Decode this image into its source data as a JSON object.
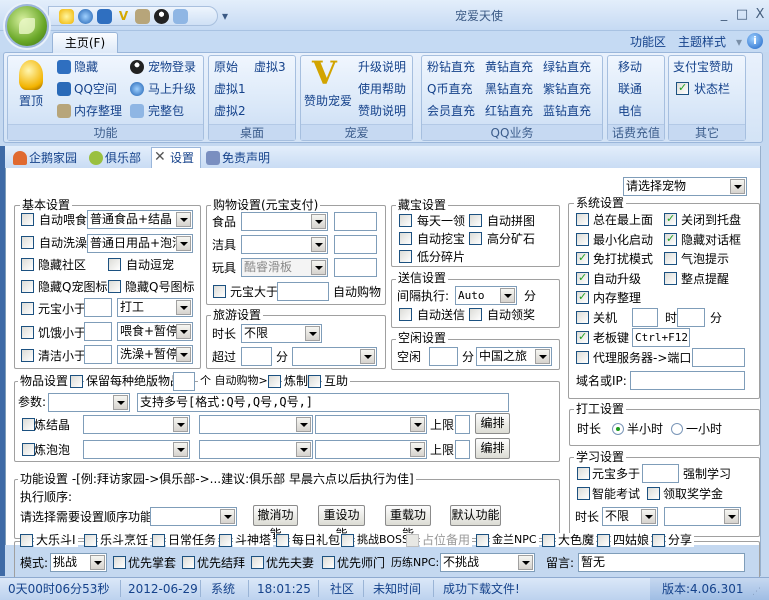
{
  "window": {
    "title": "宠爱天使",
    "minimize": "_",
    "maximize": "□",
    "close": "X"
  },
  "quick_access": {
    "icons": [
      "bulb-icon",
      "globe-upgrade-icon",
      "hide-icon",
      "v-icon",
      "memory-icon",
      "penguin-icon",
      "package-icon"
    ],
    "customize": "▾"
  },
  "ribbon": {
    "tab": "主页(F)",
    "right": {
      "function_area": "功能区",
      "theme": "主题样式",
      "theme_arrow": "▾"
    },
    "groups": {
      "function": {
        "label": "功能",
        "pin_top": "置顶",
        "hide": "隐藏",
        "qzone": "QQ空间",
        "memory": "内存整理",
        "pet_login": "宠物登录",
        "upgrade": "马上升级",
        "full_package": "完整包"
      },
      "desktop": {
        "label": "桌面",
        "original": "原始",
        "virtual3": "虚拟3",
        "virtual1": "虚拟1",
        "virtual2": "虚拟2"
      },
      "pet": {
        "label": "宠爱",
        "sponsor_pet": "赞助宠爱",
        "upgrade_notes": "升级说明",
        "help": "使用帮助",
        "sponsor_notes": "赞助说明"
      },
      "qq": {
        "label": "QQ业务",
        "items": [
          "粉钻直充",
          "黄钻直充",
          "绿钻直充",
          "Q币直充",
          "黑钻直充",
          "紫钻直充",
          "会员直充",
          "红钻直充",
          "蓝钻直充"
        ]
      },
      "phone": {
        "label": "话费充值",
        "items": [
          "移动",
          "联通",
          "电信"
        ]
      },
      "other": {
        "label": "其它",
        "alipay": "支付宝赞助",
        "statusbar": "状态栏",
        "statusbar_checked": true
      }
    }
  },
  "subtabs": [
    "企鹅家园",
    "俱乐部",
    "设置",
    "免责声明"
  ],
  "active_subtab": "设置",
  "pet_select": "请选择宠物",
  "basic": {
    "title": "基本设置",
    "auto_feed": "自动喂食",
    "feed_value": "普通食品+结晶",
    "auto_bath": "自动洗澡",
    "bath_value": "普通日用品+泡泡",
    "hide_community": "隐藏社区",
    "auto_tease": "自动逗宠",
    "hide_pet_icon": "隐藏Q宠图标",
    "hide_qq_icon": "隐藏Q号图标",
    "yb_less": "元宝小于",
    "yb_action": "打工",
    "hunger_less": "饥饿小于",
    "hunger_action": "喂食+暂停",
    "clean_less": "清洁小于",
    "clean_action": "洗澡+暂停"
  },
  "shopping": {
    "title": "购物设置(元宝支付)",
    "food": "食品",
    "cleaner": "洁具",
    "toy": "玩具",
    "toy_value": "酷睿滑板",
    "yb_more": "元宝大于",
    "auto_buy": "自动购物"
  },
  "travel": {
    "title": "旅游设置",
    "duration": "时长",
    "duration_value": "不限",
    "over": "超过",
    "minutes": "分"
  },
  "treasure": {
    "title": "藏宝设置",
    "daily": "每天一领",
    "puzzle": "自动拼图",
    "dig": "自动挖宝",
    "high_ore": "高分矿石",
    "low_frag": "低分碎片"
  },
  "mail": {
    "title": "送信设置",
    "interval": "间隔执行:",
    "interval_value": "Auto",
    "minutes": "分",
    "auto_send": "自动送信",
    "auto_claim": "自动领奖"
  },
  "idle": {
    "title": "空闲设置",
    "idle": "空闲",
    "minutes": "分",
    "idle_value": "中国之旅"
  },
  "system": {
    "title": "系统设置",
    "always_top": "总在最上面",
    "close_tray": "关闭到托盘",
    "min_start": "最小化启动",
    "hide_dialog": "隐藏对话框",
    "dnd": "免打扰模式",
    "bubble": "气泡提示",
    "auto_upgrade": "自动升级",
    "hourly": "整点提醒",
    "memory": "内存整理",
    "shutdown": "关机",
    "hour": "时",
    "minute": "分",
    "boss_key": "老板键",
    "boss_key_value": "Ctrl+F12",
    "proxy": "代理服务器->端口:",
    "domain": "域名或IP:",
    "checked": {
      "always_top": false,
      "close_tray": true,
      "min_start": false,
      "hide_dialog": true,
      "dnd": true,
      "bubble": false,
      "auto_upgrade": true,
      "hourly": false,
      "memory": true,
      "shutdown": false,
      "boss_key": true,
      "proxy": false
    }
  },
  "work": {
    "title": "打工设置",
    "duration": "时长",
    "half_hour": "半小时",
    "one_hour": "一小时",
    "selected": "半小时"
  },
  "study": {
    "title": "学习设置",
    "yb_more": "元宝多于",
    "force": "强制学习",
    "exam": "智能考试",
    "scholarship": "领取奖学金",
    "duration": "时长",
    "duration_value": "不限"
  },
  "items": {
    "title": "物品设置",
    "keep": "保留每种绝版物品",
    "unit": "个 自动购物>",
    "refine": "炼制",
    "help": "互助",
    "params": "参数:",
    "multi": "支持多号[格式:Q号,Q号,Q号,]",
    "crystal": "炼结晶",
    "bubble": "炼泡泡",
    "limit": "上限",
    "arrange": "编排"
  },
  "functions": {
    "title": "功能设置 -[例:拜访家园->俱乐部->...建议:俱乐部 早晨六点以后执行为佳]",
    "order": "执行顺序:",
    "select": "请选择需要设置顺序功能:",
    "cancel": "撤消功能",
    "reset": "重设功能",
    "reload": "重载功能",
    "default": "默认功能"
  },
  "fight": {
    "tasks": [
      "大乐斗I",
      "乐斗烹饪",
      "日常任务",
      "斗神塔",
      "每日礼包",
      "挑战BOSS",
      "占位备用",
      "金兰NPC",
      "大色魔",
      "四姑娘",
      "分享"
    ],
    "mode": "模式:",
    "mode_value": "挑战",
    "p1": "优先掌套",
    "p2": "优先结拜",
    "p3": "优先夫妻",
    "p4": "优先师门",
    "npc": "历练NPC:",
    "npc_value": "不挑战",
    "msg": "留言:",
    "msg_value": "暂无"
  },
  "status": {
    "uptime": "0天00时06分53秒",
    "date": "2012-06-29",
    "system": "系统",
    "time": "18:01:25",
    "community": "社区",
    "community_time": "未知时间",
    "message": "成功下载文件!",
    "version": "版本:4.06.301"
  }
}
